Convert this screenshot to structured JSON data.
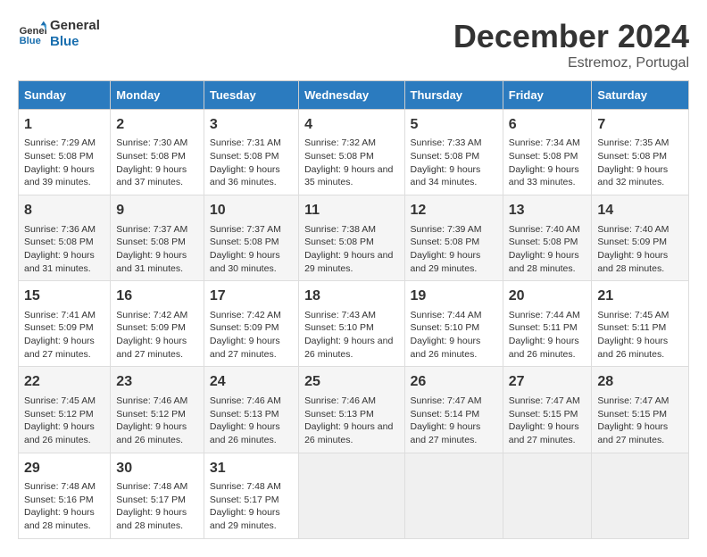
{
  "logo": {
    "line1": "General",
    "line2": "Blue"
  },
  "title": "December 2024",
  "subtitle": "Estremoz, Portugal",
  "days_of_week": [
    "Sunday",
    "Monday",
    "Tuesday",
    "Wednesday",
    "Thursday",
    "Friday",
    "Saturday"
  ],
  "weeks": [
    [
      {
        "day": 1,
        "sunrise": "Sunrise: 7:29 AM",
        "sunset": "Sunset: 5:08 PM",
        "daylight": "Daylight: 9 hours and 39 minutes."
      },
      {
        "day": 2,
        "sunrise": "Sunrise: 7:30 AM",
        "sunset": "Sunset: 5:08 PM",
        "daylight": "Daylight: 9 hours and 37 minutes."
      },
      {
        "day": 3,
        "sunrise": "Sunrise: 7:31 AM",
        "sunset": "Sunset: 5:08 PM",
        "daylight": "Daylight: 9 hours and 36 minutes."
      },
      {
        "day": 4,
        "sunrise": "Sunrise: 7:32 AM",
        "sunset": "Sunset: 5:08 PM",
        "daylight": "Daylight: 9 hours and 35 minutes."
      },
      {
        "day": 5,
        "sunrise": "Sunrise: 7:33 AM",
        "sunset": "Sunset: 5:08 PM",
        "daylight": "Daylight: 9 hours and 34 minutes."
      },
      {
        "day": 6,
        "sunrise": "Sunrise: 7:34 AM",
        "sunset": "Sunset: 5:08 PM",
        "daylight": "Daylight: 9 hours and 33 minutes."
      },
      {
        "day": 7,
        "sunrise": "Sunrise: 7:35 AM",
        "sunset": "Sunset: 5:08 PM",
        "daylight": "Daylight: 9 hours and 32 minutes."
      }
    ],
    [
      {
        "day": 8,
        "sunrise": "Sunrise: 7:36 AM",
        "sunset": "Sunset: 5:08 PM",
        "daylight": "Daylight: 9 hours and 31 minutes."
      },
      {
        "day": 9,
        "sunrise": "Sunrise: 7:37 AM",
        "sunset": "Sunset: 5:08 PM",
        "daylight": "Daylight: 9 hours and 31 minutes."
      },
      {
        "day": 10,
        "sunrise": "Sunrise: 7:37 AM",
        "sunset": "Sunset: 5:08 PM",
        "daylight": "Daylight: 9 hours and 30 minutes."
      },
      {
        "day": 11,
        "sunrise": "Sunrise: 7:38 AM",
        "sunset": "Sunset: 5:08 PM",
        "daylight": "Daylight: 9 hours and 29 minutes."
      },
      {
        "day": 12,
        "sunrise": "Sunrise: 7:39 AM",
        "sunset": "Sunset: 5:08 PM",
        "daylight": "Daylight: 9 hours and 29 minutes."
      },
      {
        "day": 13,
        "sunrise": "Sunrise: 7:40 AM",
        "sunset": "Sunset: 5:08 PM",
        "daylight": "Daylight: 9 hours and 28 minutes."
      },
      {
        "day": 14,
        "sunrise": "Sunrise: 7:40 AM",
        "sunset": "Sunset: 5:09 PM",
        "daylight": "Daylight: 9 hours and 28 minutes."
      }
    ],
    [
      {
        "day": 15,
        "sunrise": "Sunrise: 7:41 AM",
        "sunset": "Sunset: 5:09 PM",
        "daylight": "Daylight: 9 hours and 27 minutes."
      },
      {
        "day": 16,
        "sunrise": "Sunrise: 7:42 AM",
        "sunset": "Sunset: 5:09 PM",
        "daylight": "Daylight: 9 hours and 27 minutes."
      },
      {
        "day": 17,
        "sunrise": "Sunrise: 7:42 AM",
        "sunset": "Sunset: 5:09 PM",
        "daylight": "Daylight: 9 hours and 27 minutes."
      },
      {
        "day": 18,
        "sunrise": "Sunrise: 7:43 AM",
        "sunset": "Sunset: 5:10 PM",
        "daylight": "Daylight: 9 hours and 26 minutes."
      },
      {
        "day": 19,
        "sunrise": "Sunrise: 7:44 AM",
        "sunset": "Sunset: 5:10 PM",
        "daylight": "Daylight: 9 hours and 26 minutes."
      },
      {
        "day": 20,
        "sunrise": "Sunrise: 7:44 AM",
        "sunset": "Sunset: 5:11 PM",
        "daylight": "Daylight: 9 hours and 26 minutes."
      },
      {
        "day": 21,
        "sunrise": "Sunrise: 7:45 AM",
        "sunset": "Sunset: 5:11 PM",
        "daylight": "Daylight: 9 hours and 26 minutes."
      }
    ],
    [
      {
        "day": 22,
        "sunrise": "Sunrise: 7:45 AM",
        "sunset": "Sunset: 5:12 PM",
        "daylight": "Daylight: 9 hours and 26 minutes."
      },
      {
        "day": 23,
        "sunrise": "Sunrise: 7:46 AM",
        "sunset": "Sunset: 5:12 PM",
        "daylight": "Daylight: 9 hours and 26 minutes."
      },
      {
        "day": 24,
        "sunrise": "Sunrise: 7:46 AM",
        "sunset": "Sunset: 5:13 PM",
        "daylight": "Daylight: 9 hours and 26 minutes."
      },
      {
        "day": 25,
        "sunrise": "Sunrise: 7:46 AM",
        "sunset": "Sunset: 5:13 PM",
        "daylight": "Daylight: 9 hours and 26 minutes."
      },
      {
        "day": 26,
        "sunrise": "Sunrise: 7:47 AM",
        "sunset": "Sunset: 5:14 PM",
        "daylight": "Daylight: 9 hours and 27 minutes."
      },
      {
        "day": 27,
        "sunrise": "Sunrise: 7:47 AM",
        "sunset": "Sunset: 5:15 PM",
        "daylight": "Daylight: 9 hours and 27 minutes."
      },
      {
        "day": 28,
        "sunrise": "Sunrise: 7:47 AM",
        "sunset": "Sunset: 5:15 PM",
        "daylight": "Daylight: 9 hours and 27 minutes."
      }
    ],
    [
      {
        "day": 29,
        "sunrise": "Sunrise: 7:48 AM",
        "sunset": "Sunset: 5:16 PM",
        "daylight": "Daylight: 9 hours and 28 minutes."
      },
      {
        "day": 30,
        "sunrise": "Sunrise: 7:48 AM",
        "sunset": "Sunset: 5:17 PM",
        "daylight": "Daylight: 9 hours and 28 minutes."
      },
      {
        "day": 31,
        "sunrise": "Sunrise: 7:48 AM",
        "sunset": "Sunset: 5:17 PM",
        "daylight": "Daylight: 9 hours and 29 minutes."
      },
      null,
      null,
      null,
      null
    ]
  ]
}
